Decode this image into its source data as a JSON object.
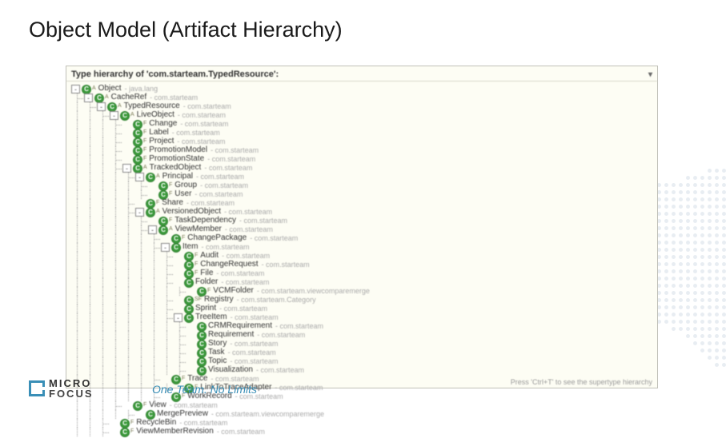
{
  "slide_title": "Object Model (Artifact Hierarchy)",
  "panel_title": "Type hierarchy of 'com.starteam.TypedResource':",
  "footer_hint": "Press 'Ctrl+T' to see the supertype hierarchy",
  "logo": {
    "line1": "MICRO",
    "line2": "FOCUS"
  },
  "tagline": "One Team. No Limits",
  "tree": [
    {
      "depth": 0,
      "exp": "-",
      "sup": "A",
      "name": "Object",
      "pkg": "java.lang"
    },
    {
      "depth": 1,
      "exp": "-",
      "sup": "A",
      "name": "CacheRef",
      "pkg": "com.starteam"
    },
    {
      "depth": 2,
      "exp": "-",
      "sup": "A",
      "name": "TypedResource",
      "pkg": "com.starteam"
    },
    {
      "depth": 3,
      "exp": "-",
      "sup": "A",
      "name": "LiveObject",
      "pkg": "com.starteam"
    },
    {
      "depth": 4,
      "exp": "",
      "sup": "F",
      "name": "Change",
      "pkg": "com.starteam"
    },
    {
      "depth": 4,
      "exp": "",
      "sup": "F",
      "name": "Label",
      "pkg": "com.starteam"
    },
    {
      "depth": 4,
      "exp": "",
      "sup": "F",
      "name": "Project",
      "pkg": "com.starteam"
    },
    {
      "depth": 4,
      "exp": "",
      "sup": "F",
      "name": "PromotionModel",
      "pkg": "com.starteam"
    },
    {
      "depth": 4,
      "exp": "",
      "sup": "F",
      "name": "PromotionState",
      "pkg": "com.starteam"
    },
    {
      "depth": 4,
      "exp": "-",
      "sup": "A",
      "name": "TrackedObject",
      "pkg": "com.starteam"
    },
    {
      "depth": 5,
      "exp": "-",
      "sup": "A",
      "name": "Principal",
      "pkg": "com.starteam"
    },
    {
      "depth": 6,
      "exp": "",
      "sup": "F",
      "name": "Group",
      "pkg": "com.starteam"
    },
    {
      "depth": 6,
      "exp": "",
      "sup": "F",
      "name": "User",
      "pkg": "com.starteam"
    },
    {
      "depth": 5,
      "exp": "",
      "sup": "F",
      "name": "Share",
      "pkg": "com.starteam"
    },
    {
      "depth": 5,
      "exp": "-",
      "sup": "A",
      "name": "VersionedObject",
      "pkg": "com.starteam"
    },
    {
      "depth": 6,
      "exp": "",
      "sup": "F",
      "name": "TaskDependency",
      "pkg": "com.starteam"
    },
    {
      "depth": 6,
      "exp": "-",
      "sup": "A",
      "name": "ViewMember",
      "pkg": "com.starteam"
    },
    {
      "depth": 7,
      "exp": "",
      "sup": "F",
      "name": "ChangePackage",
      "pkg": "com.starteam"
    },
    {
      "depth": 7,
      "exp": "-",
      "sup": "",
      "name": "Item",
      "pkg": "com.starteam"
    },
    {
      "depth": 8,
      "exp": "",
      "sup": "F",
      "name": "Audit",
      "pkg": "com.starteam"
    },
    {
      "depth": 8,
      "exp": "",
      "sup": "F",
      "name": "ChangeRequest",
      "pkg": "com.starteam"
    },
    {
      "depth": 8,
      "exp": "",
      "sup": "F",
      "name": "File",
      "pkg": "com.starteam"
    },
    {
      "depth": 8,
      "exp": "",
      "sup": "",
      "name": "Folder",
      "pkg": "com.starteam"
    },
    {
      "depth": 9,
      "exp": "",
      "sup": "F",
      "name": "VCMFolder",
      "pkg": "com.starteam.viewcomparemerge"
    },
    {
      "depth": 8,
      "exp": "",
      "sup": "SF",
      "name": "Registry",
      "pkg": "com.starteam.Category"
    },
    {
      "depth": 8,
      "exp": "",
      "sup": "",
      "name": "Sprint",
      "pkg": "com.starteam"
    },
    {
      "depth": 8,
      "exp": "-",
      "sup": "",
      "name": "TreeItem",
      "pkg": "com.starteam"
    },
    {
      "depth": 9,
      "exp": "",
      "sup": "",
      "name": "CRMRequirement",
      "pkg": "com.starteam"
    },
    {
      "depth": 9,
      "exp": "",
      "sup": "",
      "name": "Requirement",
      "pkg": "com.starteam"
    },
    {
      "depth": 9,
      "exp": "",
      "sup": "",
      "name": "Story",
      "pkg": "com.starteam"
    },
    {
      "depth": 9,
      "exp": "",
      "sup": "",
      "name": "Task",
      "pkg": "com.starteam"
    },
    {
      "depth": 9,
      "exp": "",
      "sup": "",
      "name": "Topic",
      "pkg": "com.starteam"
    },
    {
      "depth": 9,
      "exp": "",
      "sup": "",
      "name": "Visualization",
      "pkg": "com.starteam"
    },
    {
      "depth": 7,
      "exp": "",
      "sup": "F",
      "name": "Trace",
      "pkg": "com.starteam"
    },
    {
      "depth": 8,
      "exp": "",
      "sup": "F",
      "name": "LinkToTraceAdapter",
      "pkg": "com.starteam"
    },
    {
      "depth": 7,
      "exp": "",
      "sup": "F",
      "name": "WorkRecord",
      "pkg": "com.starteam"
    },
    {
      "depth": 4,
      "exp": "",
      "sup": "F",
      "name": "View",
      "pkg": "com.starteam"
    },
    {
      "depth": 5,
      "exp": "",
      "sup": "",
      "name": "MergePreview",
      "pkg": "com.starteam.viewcomparemerge"
    },
    {
      "depth": 3,
      "exp": "",
      "sup": "F",
      "name": "RecycleBin",
      "pkg": "com.starteam"
    },
    {
      "depth": 3,
      "exp": "",
      "sup": "F",
      "name": "ViewMemberRevision",
      "pkg": "com.starteam"
    }
  ]
}
